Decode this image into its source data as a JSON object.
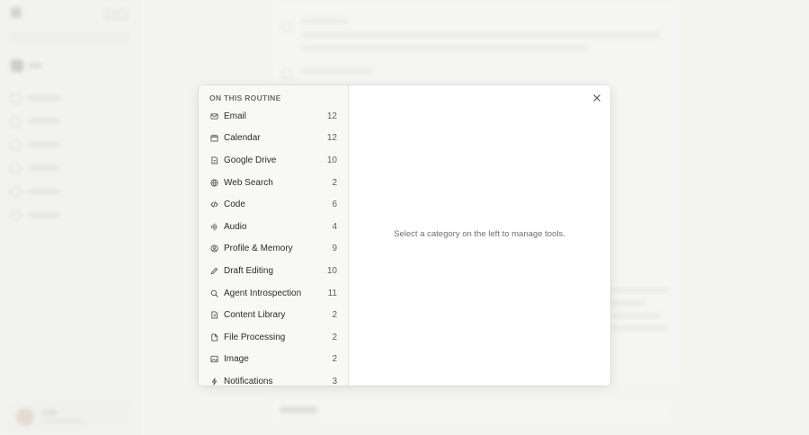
{
  "modal": {
    "section_title": "ON THIS ROUTINE",
    "empty_message": "Select a category on the left to manage tools.",
    "categories": [
      {
        "label": "Email",
        "count": "12",
        "icon": "mail-icon"
      },
      {
        "label": "Calendar",
        "count": "12",
        "icon": "calendar-icon"
      },
      {
        "label": "Google Drive",
        "count": "10",
        "icon": "drive-icon"
      },
      {
        "label": "Web Search",
        "count": "2",
        "icon": "globe-icon"
      },
      {
        "label": "Code",
        "count": "6",
        "icon": "code-icon"
      },
      {
        "label": "Audio",
        "count": "4",
        "icon": "audio-icon"
      },
      {
        "label": "Profile & Memory",
        "count": "9",
        "icon": "profile-icon"
      },
      {
        "label": "Draft Editing",
        "count": "10",
        "icon": "pencil-icon"
      },
      {
        "label": "Agent Introspection",
        "count": "11",
        "icon": "search-icon"
      },
      {
        "label": "Content Library",
        "count": "2",
        "icon": "library-icon"
      },
      {
        "label": "File Processing",
        "count": "2",
        "icon": "file-icon"
      },
      {
        "label": "Image",
        "count": "2",
        "icon": "image-icon"
      },
      {
        "label": "Notifications",
        "count": "3",
        "icon": "bolt-icon"
      }
    ]
  },
  "colors": {
    "modal_bg": "#ffffff",
    "panel_bg": "#f8f8f6",
    "text": "#2b2b28",
    "muted": "#6f6f6a"
  }
}
